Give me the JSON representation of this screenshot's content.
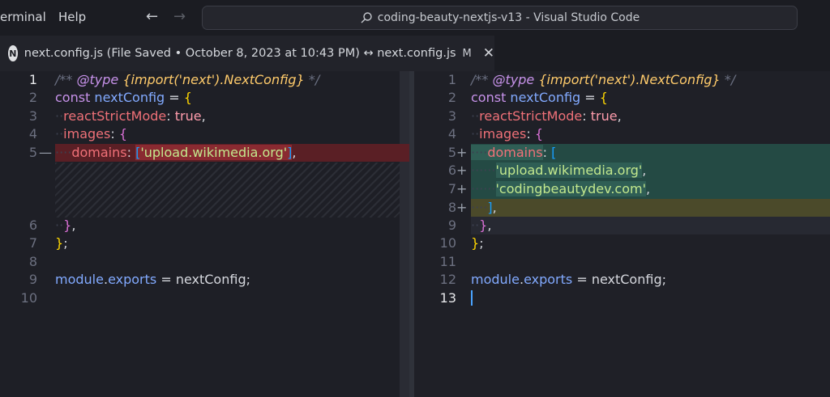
{
  "titlebar": {
    "menu": [
      "erminal",
      "Help"
    ],
    "back_icon": "arrow-left-icon",
    "forward_icon": "arrow-right-icon",
    "search_icon": "search-icon",
    "command_center": "coding-beauty-nextjs-v13 - Visual Studio Code"
  },
  "tab": {
    "icon_letter": "N",
    "title": "next.config.js (File Saved • October 8, 2023 at 10:43 PM) ↔ next.config.js",
    "modified": "M",
    "close": "✕"
  },
  "diff": {
    "arrow": "→",
    "left": {
      "line_numbers": [
        "1",
        "2",
        "3",
        "4",
        "5",
        "6",
        "7",
        "8",
        "9",
        "10"
      ],
      "removed_sign": "—",
      "lines": {
        "l1": {
          "a": "/** ",
          "b": "@type",
          "c": " {",
          "d": "import",
          "e": "('next')",
          "f": ".NextConfig}",
          "g": " */"
        },
        "l2": {
          "a": "const ",
          "b": "nextConfig",
          "c": " = ",
          "d": "{"
        },
        "l3": {
          "a": "reactStrictMode",
          "b": ": ",
          "c": "true",
          "d": ","
        },
        "l4": {
          "a": "images",
          "b": ": ",
          "c": "{"
        },
        "l5": {
          "a": "domains",
          "b": ": ",
          "c": "[",
          "d": "'upload.wikimedia.org'",
          "e": "]",
          "f": ","
        },
        "l6": {
          "a": "}",
          "b": ","
        },
        "l7": {
          "a": "}",
          "b": ";"
        },
        "l9": {
          "a": "module",
          "b": ".",
          "c": "exports",
          "d": " = ",
          "e": "nextConfig",
          "f": ";"
        }
      }
    },
    "right": {
      "line_numbers": [
        "1",
        "2",
        "3",
        "4",
        "5",
        "6",
        "7",
        "8",
        "9",
        "10",
        "11",
        "12",
        "13"
      ],
      "added_sign": "+",
      "lines": {
        "l1": {
          "a": "/** ",
          "b": "@type",
          "c": " {",
          "d": "import",
          "e": "('next')",
          "f": ".NextConfig}",
          "g": " */"
        },
        "l2": {
          "a": "const ",
          "b": "nextConfig",
          "c": " = ",
          "d": "{"
        },
        "l3": {
          "a": "reactStrictMode",
          "b": ": ",
          "c": "true",
          "d": ","
        },
        "l4": {
          "a": "images",
          "b": ": ",
          "c": "{"
        },
        "l5": {
          "a": "domains",
          "b": ": ",
          "c": "["
        },
        "l6": {
          "a": "'upload.wikimedia.org'",
          "b": ","
        },
        "l7": {
          "a": "'codingbeautydev.com'",
          "b": ","
        },
        "l8": {
          "a": "]",
          "b": ","
        },
        "l9": {
          "a": "}",
          "b": ","
        },
        "l10": {
          "a": "}",
          "b": ";"
        },
        "l12": {
          "a": "module",
          "b": ".",
          "c": "exports",
          "d": " = ",
          "e": "nextConfig",
          "f": ";"
        }
      }
    }
  }
}
